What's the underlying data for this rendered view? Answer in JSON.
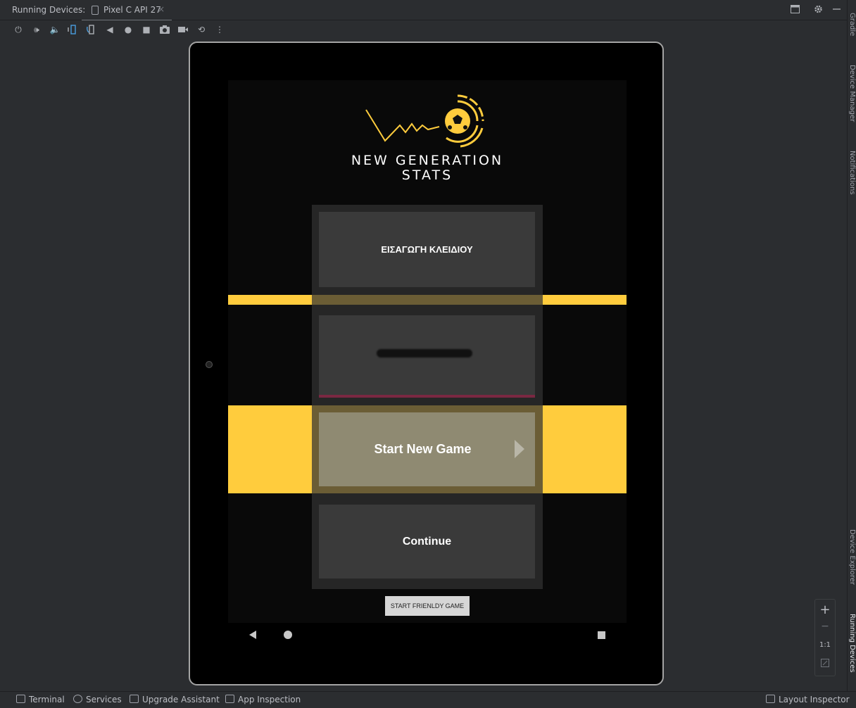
{
  "topbar": {
    "running_devices_label": "Running Devices:",
    "tab_label": "Pixel C API 27",
    "tab_close": "×"
  },
  "toolbar": {
    "icons": [
      "power-icon",
      "volume-up-icon",
      "volume-down-icon",
      "rotate-left-icon",
      "rotate-right-icon",
      "back-icon",
      "home-icon",
      "overview-icon",
      "screenshot-icon",
      "screen-record-icon",
      "reset-icon",
      "more-icon"
    ]
  },
  "side_tools": {
    "gradle": "Gradle",
    "device_manager": "Device Manager",
    "notifications": "Notifications",
    "device_explorer": "Device Explorer",
    "running_devices": "Running Devices"
  },
  "app": {
    "brand_line1": "NEW GENERATION",
    "brand_line2": "STATS",
    "key_button": "ΕΙΣΑΓΩΓΗ ΚΛΕΙΔΙΟΥ",
    "start_new_game": "Start New Game",
    "continue": "Continue",
    "start_friendly": "START FRIENLDY GAME",
    "accent_color": "#ffcc3d"
  },
  "zoom": {
    "plus": "+",
    "minus": "−",
    "one_to_one": "1:1"
  },
  "statusbar": {
    "terminal": "Terminal",
    "services": "Services",
    "upgrade_assistant": "Upgrade Assistant",
    "app_inspection": "App Inspection",
    "layout_inspector": "Layout Inspector"
  }
}
